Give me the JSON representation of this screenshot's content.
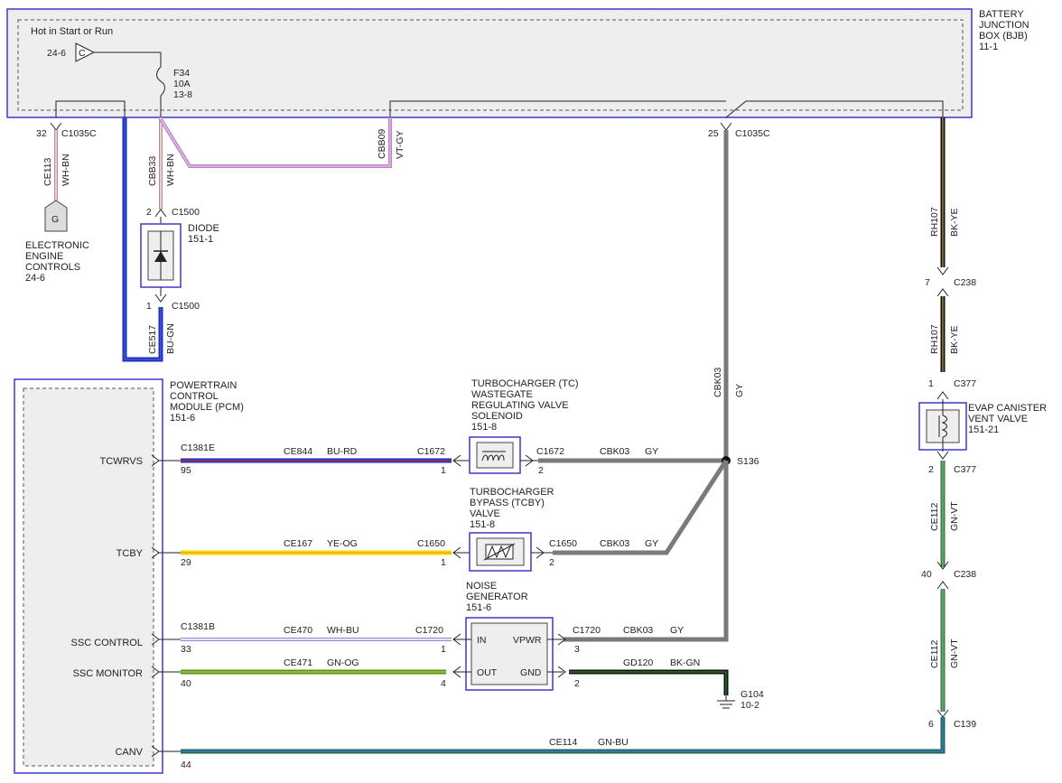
{
  "bjb": {
    "title_lines": [
      "BATTERY",
      "JUNCTION",
      "BOX (BJB)",
      "11-1"
    ],
    "hot_label": "Hot in Start or Run",
    "ref_c": "24-6",
    "c_symbol": "C",
    "fuse_lines": [
      "F34",
      "10A",
      "13-8"
    ]
  },
  "eec": {
    "pin": "32",
    "connector": "C1035C",
    "circuit": "CE113",
    "color": "WH-BN",
    "symbol": "G",
    "label_lines": [
      "ELECTRONIC",
      "ENGINE",
      "CONTROLS",
      "24-6"
    ]
  },
  "diode": {
    "wire_circuit": "CBB33",
    "wire_color": "WH-BN",
    "pin_top": "2",
    "conn_top": "C1500",
    "label_lines": [
      "DIODE",
      "151-1"
    ],
    "pin_bottom": "1",
    "conn_bottom": "C1500",
    "out_circuit": "CE517",
    "out_color": "BU-GN"
  },
  "vt_wire": {
    "circuit": "CBB09",
    "color": "VT-GY"
  },
  "gy_feed": {
    "pin": "25",
    "connector": "C1035C",
    "circuit": "CBK03",
    "color": "GY"
  },
  "evap": {
    "wire1_circuit": "RH107",
    "wire1_color": "BK-YE",
    "c238_pin": "7",
    "c238": "C238",
    "wire2_circuit": "RH107",
    "wire2_color": "BK-YE",
    "c377_pin_top": "1",
    "c377_top": "C377",
    "label_lines": [
      "EVAP CANISTER",
      "VENT VALVE",
      "151-21"
    ],
    "c377_pin_bottom": "2",
    "c377_bottom": "C377",
    "wire3_circuit": "CE112",
    "wire3_color": "GN-VT",
    "c238b_pin": "40",
    "c238b": "C238",
    "wire4_circuit": "CE112",
    "wire4_color": "GN-VT",
    "c139_pin": "6",
    "c139": "C139"
  },
  "pcm": {
    "label_lines": [
      "POWERTRAIN",
      "CONTROL",
      "MODULE (PCM)",
      "151-6"
    ],
    "signals": [
      "TCWRVS",
      "TCBY",
      "SSC CONTROL",
      "SSC MONITOR",
      "CANV"
    ]
  },
  "tcwrvs": {
    "conn": "C1381E",
    "pin": "95",
    "circuit": "CE844",
    "color": "BU-RD",
    "sol_conn_in": "C1672",
    "sol_pin_in": "1",
    "sol_conn_out": "C1672",
    "sol_pin_out": "2",
    "out_circuit": "CBK03",
    "out_color": "GY",
    "splice": "S136",
    "label_lines": [
      "TURBOCHARGER (TC)",
      "WASTEGATE",
      "REGULATING VALVE",
      "SOLENOID",
      "151-8"
    ]
  },
  "tcby": {
    "pin": "29",
    "circuit": "CE167",
    "color": "YE-OG",
    "conn_in": "C1650",
    "pin_in": "1",
    "conn_out": "C1650",
    "pin_out": "2",
    "out_circuit": "CBK03",
    "out_color": "GY",
    "label_lines": [
      "TURBOCHARGER",
      "BYPASS (TCBY)",
      "VALVE",
      "151-8"
    ]
  },
  "noise": {
    "label_lines": [
      "NOISE",
      "GENERATOR",
      "151-6"
    ],
    "in_label": "IN",
    "out_label": "OUT",
    "vpwr_label": "VPWR",
    "gnd_label": "GND",
    "ssc_control_conn": "C1381B",
    "ssc_control_pin": "33",
    "ssc_control_circuit": "CE470",
    "ssc_control_color": "WH-BU",
    "in_conn": "C1720",
    "in_pin": "1",
    "vpwr_conn": "C1720",
    "vpwr_pin": "3",
    "vpwr_circuit": "CBK03",
    "vpwr_color": "GY",
    "ssc_monitor_pin": "40",
    "ssc_monitor_circuit": "CE471",
    "ssc_monitor_color": "GN-OG",
    "out_pin": "4",
    "gnd_pin": "2",
    "gnd_circuit": "GD120",
    "gnd_color": "BK-GN",
    "ground_lines": [
      "G104",
      "10-2"
    ]
  },
  "canv": {
    "pin": "44",
    "circuit": "CE114",
    "color": "GN-BU"
  },
  "colors": {
    "module_border": "#3a3acc",
    "bjb_fill": "#eeeeee",
    "wire_blue": "#1a2fc0",
    "wire_violet": "#c080c8",
    "wire_gray": "#7a7a7a",
    "wire_black": "#111111",
    "wire_yellow": "#f2dd00",
    "wire_green": "#2e8b2e",
    "wire_teal": "#1e6a5a"
  }
}
